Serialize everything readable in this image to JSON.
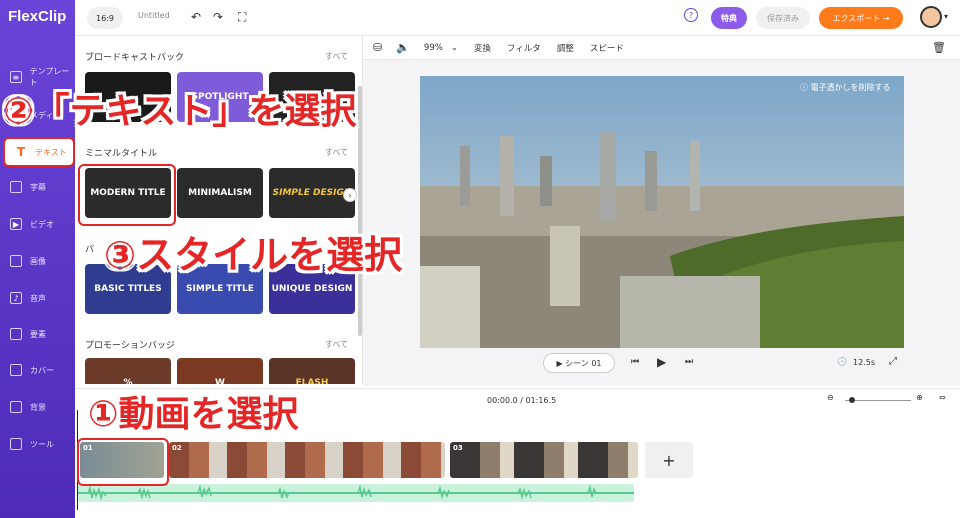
{
  "app": {
    "name": "FlexClip"
  },
  "topbar": {
    "ratio": "16:9",
    "doc_title": "Untitled",
    "help": "?",
    "premium": "特典",
    "saved": "保存済み",
    "export": "エクスポート →"
  },
  "sidebar": {
    "items": [
      {
        "label": "テンプレート",
        "icon": "layers-icon"
      },
      {
        "label": "メディア",
        "icon": "media-icon"
      },
      {
        "label": "テキスト",
        "icon": "text-icon"
      },
      {
        "label": "字幕",
        "icon": "subtitle-icon"
      },
      {
        "label": "ビデオ",
        "icon": "video-icon"
      },
      {
        "label": "画像",
        "icon": "image-icon"
      },
      {
        "label": "音声",
        "icon": "music-icon"
      },
      {
        "label": "要素",
        "icon": "elements-icon"
      },
      {
        "label": "カバー",
        "icon": "cover-icon"
      },
      {
        "label": "背景",
        "icon": "background-icon"
      },
      {
        "label": "ツール",
        "icon": "toolbox-icon"
      }
    ]
  },
  "panel": {
    "sections": [
      {
        "title": "ブロードキャストパック",
        "all": "すべて"
      },
      {
        "title": "ミニマルタイトル",
        "all": "すべて"
      },
      {
        "title": "パ",
        "all": ""
      },
      {
        "title": "プロモーションバッジ",
        "all": "すべて"
      }
    ],
    "minimal_titles": [
      "MODERN TITLE",
      "MINIMALISM",
      "SIMPLE DESIGN"
    ],
    "basic_titles": [
      "BASIC TITLES",
      "SIMPLE TITLE",
      "UNIQUE DESIGN"
    ],
    "badges": [
      "%",
      "W",
      "FLASH"
    ],
    "broadcast": [
      "",
      "SPOTLIGHT",
      "TODAY"
    ]
  },
  "editor_toolbar": {
    "zoom": "99%",
    "items": [
      "変換",
      "フィルタ",
      "調整",
      "スピード"
    ]
  },
  "preview": {
    "watermark": "ⓘ 電子透かしを削除する",
    "scene": "▶ シーン 01",
    "duration": "12.5s"
  },
  "timeline": {
    "time": "00:00.0 / 01:16.5",
    "clips": [
      "01",
      "02",
      "03"
    ],
    "add": "+"
  },
  "annotations": {
    "step1": "①動画を選択",
    "step2": "②「テキスト」を選択",
    "step3": "③スタイルを選択"
  },
  "colors": {
    "accent": "#6a44d8",
    "export": "#ff7a1a",
    "annotation": "#e52626"
  }
}
